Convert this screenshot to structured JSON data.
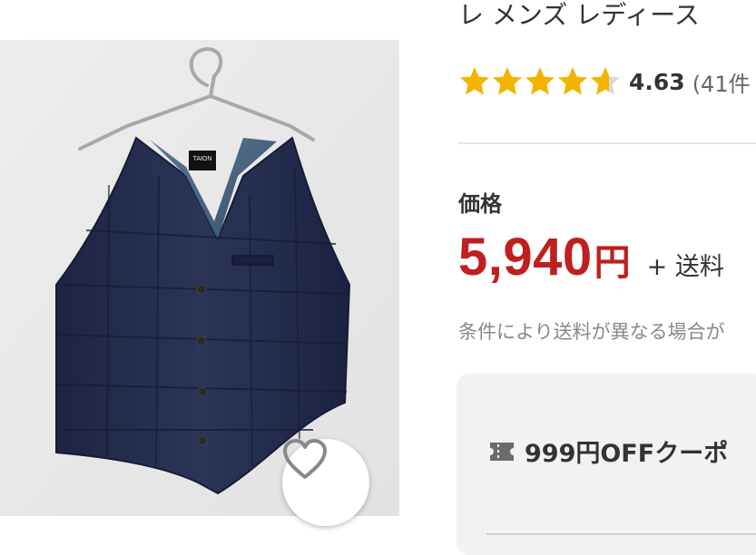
{
  "product": {
    "title_fragment": "レ メンズ レディース",
    "rating": {
      "value": "4.63",
      "review_count_text": "(41件",
      "stars": 4.63,
      "star_color": "#f5b301"
    },
    "price": {
      "label": "価格",
      "amount": "5,940",
      "currency": "円",
      "shipping": "+ 送料",
      "color": "#bf1f1f"
    },
    "shipping_note": "条件により送料が異なる場合が",
    "coupon": {
      "icon": "coupon-ticket-icon",
      "text": "999円OFFクーポ"
    }
  },
  "image": {
    "label": "TAION",
    "favorite_icon": "heart-icon"
  }
}
